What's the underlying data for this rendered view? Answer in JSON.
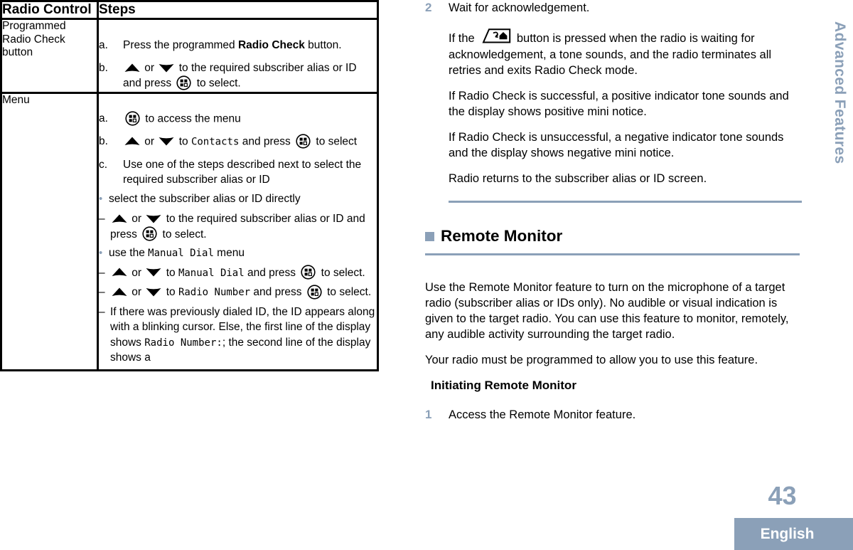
{
  "document": {
    "page_number": "43",
    "language": "English",
    "side_tab": "Advanced Features"
  },
  "table": {
    "headers": {
      "control": "Radio Control",
      "steps": "Steps"
    },
    "rows": [
      {
        "control": "Programmed Radio Check button",
        "steps": [
          {
            "marker": "a.",
            "text_before": "Press the programmed ",
            "bold": "Radio Check",
            "text_after": " button."
          },
          {
            "marker": "b.",
            "icon_up": "up-arrow-icon",
            "text_mid_1": " or ",
            "icon_down": "down-arrow-icon",
            "text_mid_2": " to the required subscriber alias or ID and press ",
            "icon_menu": "menu-icon",
            "text_end": " to select."
          }
        ]
      },
      {
        "control": "Menu",
        "steps": [
          {
            "marker": "a.",
            "icon_menu": "menu-icon",
            "text_end": " to access the menu"
          },
          {
            "marker": "b.",
            "text_mid_1": " or ",
            "text_mid_2": " to ",
            "mono": "Contacts",
            "text_mid_3": " and press ",
            "text_end": " to select"
          },
          {
            "marker": "c.",
            "text": "Use one of the steps described next to select the required subscriber alias or ID"
          }
        ],
        "bullets": [
          {
            "text": "select the subscriber alias or ID directly",
            "dashes": [
              {
                "text_mid_1": " or ",
                "text_mid_2": " to the required subscriber alias or ID and press ",
                "text_end": " to select."
              }
            ]
          },
          {
            "text_before": "use the ",
            "mono": "Manual Dial",
            "text_after": " menu",
            "dashes": [
              {
                "text_mid_1": " or ",
                "text_mid_2": " to ",
                "mono": "Manual Dial",
                "text_mid_3": " and press ",
                "text_end": " to select."
              },
              {
                "text_mid_1": " or ",
                "text_mid_2": " to ",
                "mono": "Radio Number",
                "text_mid_3": " and press ",
                "text_end": " to select."
              },
              {
                "text_before": "If there was previously dialed ID, the ID appears along with a blinking cursor.  Else, the first line of the display shows ",
                "mono": "Radio Number:",
                "text_after": "; the second line of the display shows a"
              }
            ]
          }
        ]
      }
    ]
  },
  "right": {
    "step2": {
      "number": "2",
      "text": "Wait for acknowledgement."
    },
    "notes": [
      {
        "prefix": "If the ",
        "icon": "back-home-button-icon",
        "suffix": " button is pressed when the radio is waiting for acknowledgement, a tone sounds, and the radio terminates all retries and exits Radio Check mode."
      }
    ],
    "paragraphs": [
      "If Radio Check is successful, a positive indicator tone sounds and the display shows positive mini notice.",
      "If Radio Check is unsuccessful, a negative indicator tone sounds and the display shows negative mini notice.",
      "Radio returns to the subscriber alias or ID screen."
    ],
    "section": {
      "title": "Remote Monitor",
      "body": [
        "Use the Remote Monitor feature to turn on the microphone of a target radio (subscriber alias or IDs only).  No audible or visual indication is given to the target radio.  You can use this feature to monitor, remotely, any audible activity surrounding the target radio.",
        "Your radio must be programmed to allow you to use this feature."
      ],
      "subsection": {
        "title": "Initiating Remote Monitor",
        "step": {
          "number": "1",
          "text": "Access the Remote Monitor feature."
        }
      }
    }
  },
  "colors": {
    "accent": "#8ba0b8",
    "text": "#000000",
    "background": "#ffffff"
  }
}
